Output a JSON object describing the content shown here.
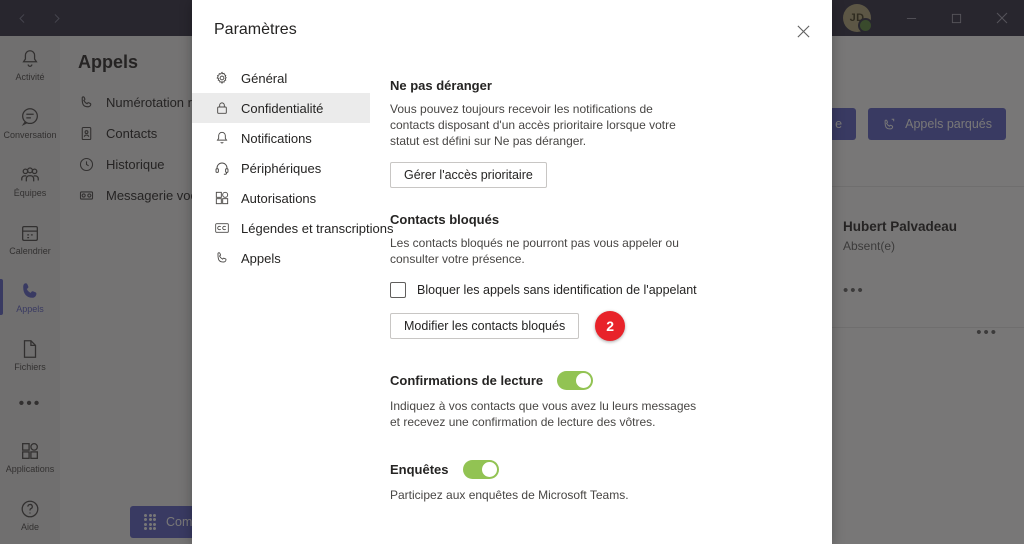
{
  "window": {
    "back_icon": "chevron-left-icon",
    "forward_icon": "chevron-right-icon",
    "avatar_initials": "JD",
    "minimize_label": "Réduire",
    "maximize_label": "Agrandir",
    "close_label": "Fermer"
  },
  "rail": {
    "items": [
      {
        "label": "Activité",
        "icon": "bell-icon"
      },
      {
        "label": "Conversation",
        "icon": "chat-icon"
      },
      {
        "label": "Équipes",
        "icon": "people-icon"
      },
      {
        "label": "Calendrier",
        "icon": "calendar-icon"
      },
      {
        "label": "Appels",
        "icon": "phone-icon",
        "active": true
      },
      {
        "label": "Fichiers",
        "icon": "file-icon"
      }
    ],
    "more_label": "•••",
    "bottom_items": [
      {
        "label": "Applications",
        "icon": "grid-icon"
      },
      {
        "label": "Aide",
        "icon": "help-icon"
      }
    ]
  },
  "calls_pane": {
    "title": "Appels",
    "items": [
      {
        "label": "Numérotation rapide",
        "icon": "phone-icon"
      },
      {
        "label": "Contacts",
        "icon": "contact-card-icon"
      },
      {
        "label": "Historique",
        "icon": "clock-icon"
      },
      {
        "label": "Messagerie vocale",
        "icon": "voicemail-icon"
      }
    ]
  },
  "main_pane": {
    "toolbar": [
      {
        "label": "e",
        "icon": "phone-icon"
      },
      {
        "label": "Appels parqués",
        "icon": "parked-call-icon"
      }
    ],
    "contact": {
      "name": "Hubert Palvadeau",
      "status": "Absent(e)",
      "more_label": "•••"
    },
    "more_label": "•••",
    "compose_label": "Composer un",
    "compose_icon": "dialpad-icon"
  },
  "modal": {
    "title": "Paramètres",
    "close_icon": "close-icon",
    "nav": [
      {
        "label": "Général",
        "icon": "gear-icon",
        "active": false
      },
      {
        "label": "Confidentialité",
        "icon": "lock-icon",
        "active": true
      },
      {
        "label": "Notifications",
        "icon": "bell-icon",
        "active": false
      },
      {
        "label": "Périphériques",
        "icon": "headset-icon",
        "active": false
      },
      {
        "label": "Autorisations",
        "icon": "grid-icon",
        "active": false
      },
      {
        "label": "Légendes et transcriptions",
        "icon": "cc-icon",
        "active": false
      },
      {
        "label": "Appels",
        "icon": "phone-icon",
        "active": false
      }
    ],
    "sections": {
      "dnd": {
        "title": "Ne pas déranger",
        "description": "Vous pouvez toujours recevoir les notifications de contacts disposant d'un accès prioritaire lorsque votre statut est défini sur Ne pas déranger.",
        "button": "Gérer l'accès prioritaire"
      },
      "blocked": {
        "title": "Contacts bloqués",
        "description": "Les contacts bloqués ne pourront pas vous appeler ou consulter votre présence.",
        "checkbox_label": "Bloquer les appels sans identification de l'appelant",
        "checkbox_checked": false,
        "button": "Modifier les contacts bloqués",
        "step_badge": "2"
      },
      "read_receipts": {
        "title": "Confirmations de lecture",
        "toggle_on": true,
        "description": "Indiquez à vos contacts que vous avez lu leurs messages et recevez une confirmation de lecture des vôtres."
      },
      "surveys": {
        "title": "Enquêtes",
        "toggle_on": true,
        "description": "Participez aux enquêtes de Microsoft Teams."
      }
    }
  },
  "colors": {
    "brand_purple": "#5b5fc7",
    "titlebar": "#2d2c3f",
    "toggle_green": "#92c353",
    "badge_red": "#e8232a",
    "presence_away": "#f8b000",
    "presence_available": "#5a8a3c"
  }
}
